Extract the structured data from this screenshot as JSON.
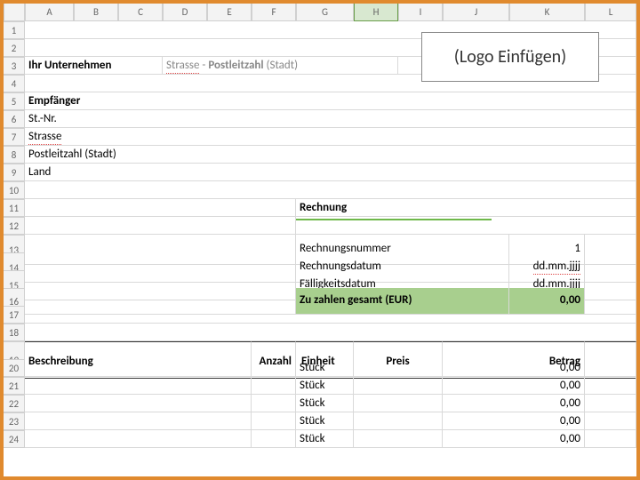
{
  "columns": [
    "",
    "A",
    "B",
    "C",
    "D",
    "E",
    "F",
    "G",
    "H",
    "I",
    "J",
    "K",
    "L"
  ],
  "active_col_index": 8,
  "rows": [
    "1",
    "2",
    "3",
    "4",
    "5",
    "6",
    "7",
    "8",
    "9",
    "10",
    "11",
    "12",
    "13",
    "14",
    "15",
    "16",
    "17",
    "18",
    "19",
    "20",
    "21",
    "22",
    "23",
    "24"
  ],
  "header": {
    "company": "Ihr Unternehmen",
    "street": "Strasse",
    "sep": " - ",
    "postal": "Postleitzahl",
    "city_paren": " (Stadt)",
    "logo_label": "(Logo Einfügen)"
  },
  "recipient": {
    "title": "Empfänger",
    "taxno": "St.-Nr.",
    "street": "Strasse",
    "postal_city": "Postleitzahl (Stadt)",
    "country": "Land"
  },
  "invoice": {
    "title": "Rechnung",
    "number_label": "Rechnungsnummer",
    "number_value": "1",
    "date_label": "Rechnungsdatum",
    "date_value": "dd.mm.jjjj",
    "due_label": "Fälligkeitsdatum",
    "due_value": "dd.mm.jjjj",
    "total_label": "Zu zahlen gesamt (EUR)",
    "total_value": "0,00"
  },
  "table": {
    "headers": {
      "desc": "Beschreibung",
      "qty": "Anzahl",
      "unit": "Einheit",
      "price": "Preis",
      "amount": "Betrag"
    },
    "rows": [
      {
        "desc": "",
        "qty": "",
        "unit": "Stück",
        "price": "",
        "amount": "0,00"
      },
      {
        "desc": "",
        "qty": "",
        "unit": "Stück",
        "price": "",
        "amount": "0,00"
      },
      {
        "desc": "",
        "qty": "",
        "unit": "Stück",
        "price": "",
        "amount": "0,00"
      },
      {
        "desc": "",
        "qty": "",
        "unit": "Stück",
        "price": "",
        "amount": "0,00"
      },
      {
        "desc": "",
        "qty": "",
        "unit": "Stück",
        "price": "",
        "amount": "0,00"
      }
    ]
  }
}
